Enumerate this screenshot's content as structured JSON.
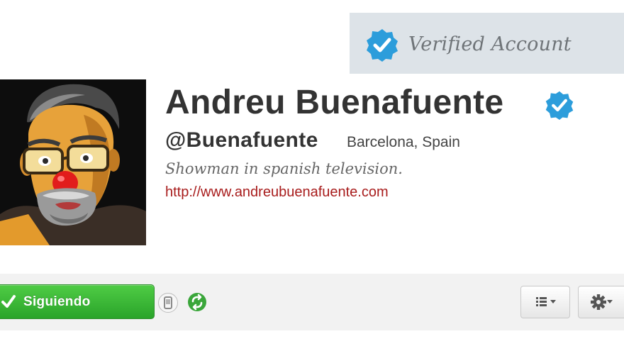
{
  "verified": {
    "label": "Verified Account"
  },
  "profile": {
    "name": "Andreu Buenafuente",
    "handle": "@Buenafuente",
    "location": "Barcelona, Spain",
    "bio": "Showman in spanish television.",
    "url": "http://www.andreubuenafuente.com"
  },
  "actions": {
    "follow_label": "Siguiendo"
  },
  "icons": {
    "verified_badge": "verified-checkmark-icon",
    "follow_check": "checkmark-icon",
    "sms": "sms-device-icon",
    "retweets": "retweet-icon",
    "lists": "list-icon",
    "settings": "gear-icon",
    "dropdown": "caret-down-icon"
  },
  "colors": {
    "verified_blue": "#2c9ddb",
    "follow_green": "#3bb83a",
    "url_red": "#a81c1c",
    "name_text": "#333333"
  }
}
